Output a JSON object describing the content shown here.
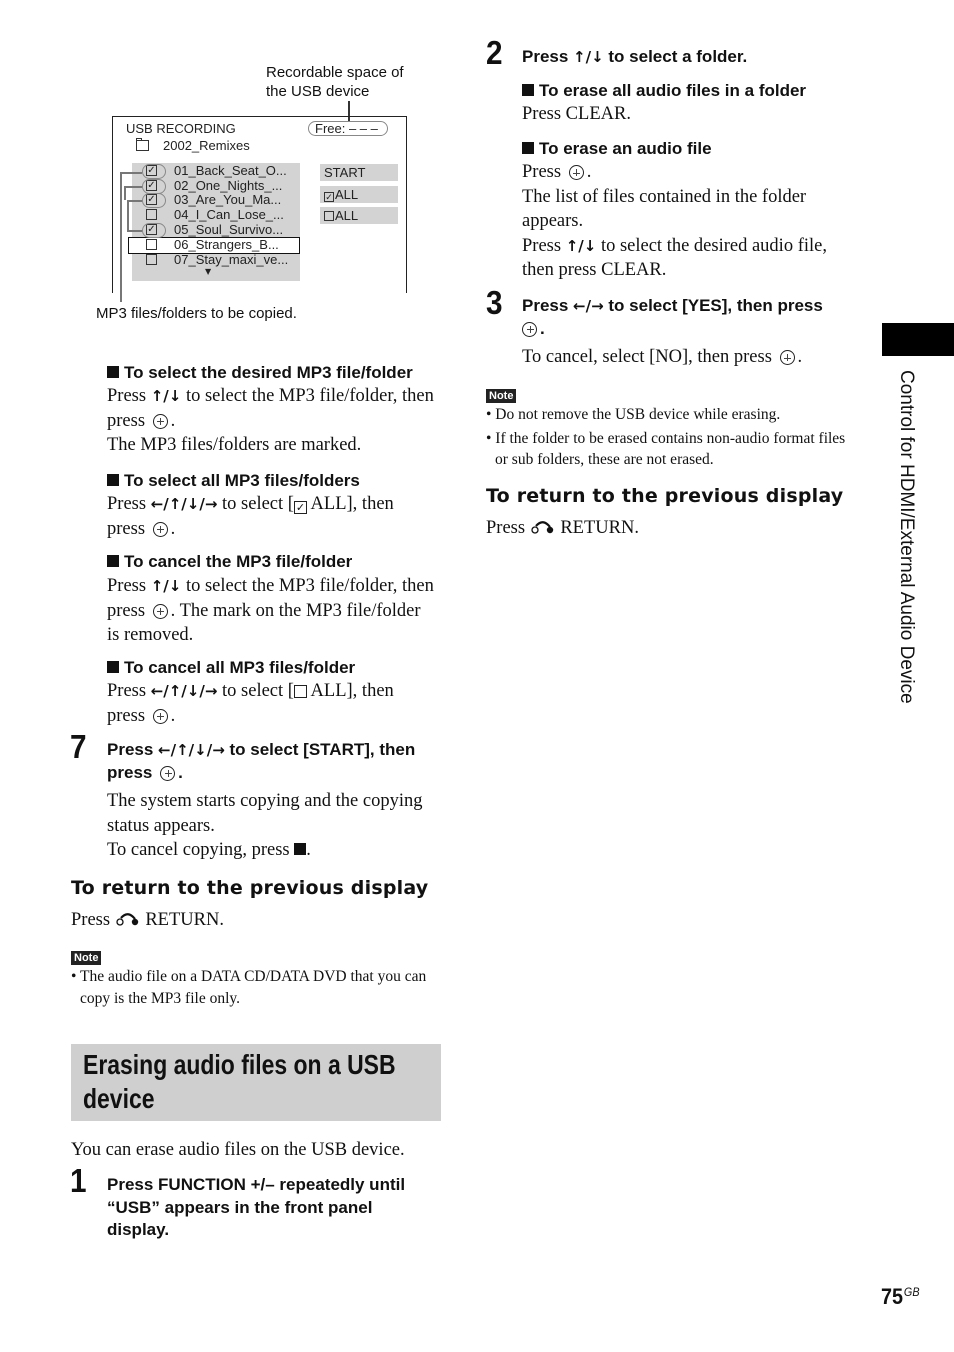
{
  "diagram": {
    "callout_top_line1": "Recordable space of",
    "callout_top_line2": "the USB device",
    "callout_bottom": "MP3 files/folders to be copied.",
    "screen_title": "USB RECORDING",
    "free_label": "Free:  – – –",
    "folder_name": "2002_Remixes",
    "files": [
      {
        "name": "01_Back_Seat_O...",
        "checked": true
      },
      {
        "name": "02_One_Nights_...",
        "checked": true
      },
      {
        "name": "03_Are_You_Ma...",
        "checked": true
      },
      {
        "name": "04_I_Can_Lose_...",
        "checked": false
      },
      {
        "name": "05_Soul_Survivo...",
        "checked": true
      },
      {
        "name": "06_Strangers_B...",
        "checked": false,
        "selected": true
      },
      {
        "name": "07_Stay_maxi_ve...",
        "checked": false
      }
    ],
    "options": {
      "start": "START",
      "check_all": "ALL",
      "uncheck_all": "ALL"
    },
    "scroll_indicator": "▼"
  },
  "left": {
    "select_file": {
      "heading": "To select the desired MP3 file/folder",
      "l1_pre": "Press ",
      "l1_arrows": "↑/↓",
      "l1_post": " to select the MP3 file/folder, then",
      "l2": "press",
      "l3": "The MP3 files/folders are marked."
    },
    "select_all": {
      "heading": "To select all MP3 files/folders",
      "l1_pre": "Press ",
      "l1_arrows": "←/↑/↓/→",
      "l1_mid": " to select [",
      "l1_cb": "✓",
      "l1_post": " ALL], then",
      "l2": "press"
    },
    "cancel_file": {
      "heading": "To cancel the MP3 file/folder",
      "l1_pre": "Press ",
      "l1_arrows": "↑/↓",
      "l1_post": " to select the MP3 file/folder, then",
      "l2_pre": "press",
      "l2_post": ". The mark on the MP3 file/folder",
      "l3": "is removed."
    },
    "cancel_all": {
      "heading": "To cancel all MP3 files/folder",
      "l1_pre": "Press ",
      "l1_arrows": "←/↑/↓/→",
      "l1_mid": " to select [",
      "l1_post": " ALL], then",
      "l2": "press"
    },
    "step7": {
      "num": "7",
      "l1_pre": "Press ",
      "l1_arrows": "←/↑/↓/→",
      "l1_post": " to select [START], then",
      "l2": "press",
      "b1": "The system starts copying and the copying",
      "b2": "status appears.",
      "b3": "To cancel copying, press"
    },
    "return": {
      "heading": "To return to the previous display",
      "pre": "Press",
      "post": "RETURN."
    },
    "note": {
      "badge": "Note",
      "items": [
        "• The audio file on a DATA CD/DATA DVD that you can copy is the MP3 file only."
      ]
    },
    "banner": {
      "l1": "Erasing audio files on a USB",
      "l2": "device"
    },
    "intro": "You can erase audio files on the USB device.",
    "step1": {
      "num": "1",
      "l1": "Press FUNCTION +/– repeatedly until",
      "l2": "“USB” appears in the front panel",
      "l3": "display."
    }
  },
  "right": {
    "step2": {
      "num": "2",
      "pre": "Press ",
      "arrows": "↑/↓",
      "post": " to select a folder."
    },
    "erase_all": {
      "heading": "To erase all audio files in a folder",
      "body": "Press CLEAR."
    },
    "erase_one": {
      "heading": "To erase an audio file",
      "l1": "Press",
      "l2": "The list of files contained in the folder",
      "l3": "appears.",
      "l4_pre": "Press ",
      "l4_arrows": "↑/↓",
      "l4_post": " to select the desired audio file,",
      "l5": "then press CLEAR."
    },
    "step3": {
      "num": "3",
      "pre": "Press ",
      "arrows": "←/→",
      "post": " to select [YES], then press",
      "cancel": "To cancel, select [NO], then press"
    },
    "note": {
      "badge": "Note",
      "items": [
        "• Do not remove the USB device while erasing.",
        "• If the folder to be erased contains non-audio format files or sub folders, these are not erased."
      ]
    },
    "return": {
      "heading": "To return to the previous display",
      "pre": "Press",
      "post": "RETURN."
    }
  },
  "side_tab_label": "Control for HDMI/External Audio Device",
  "page": {
    "number": "75",
    "suffix": "GB"
  }
}
